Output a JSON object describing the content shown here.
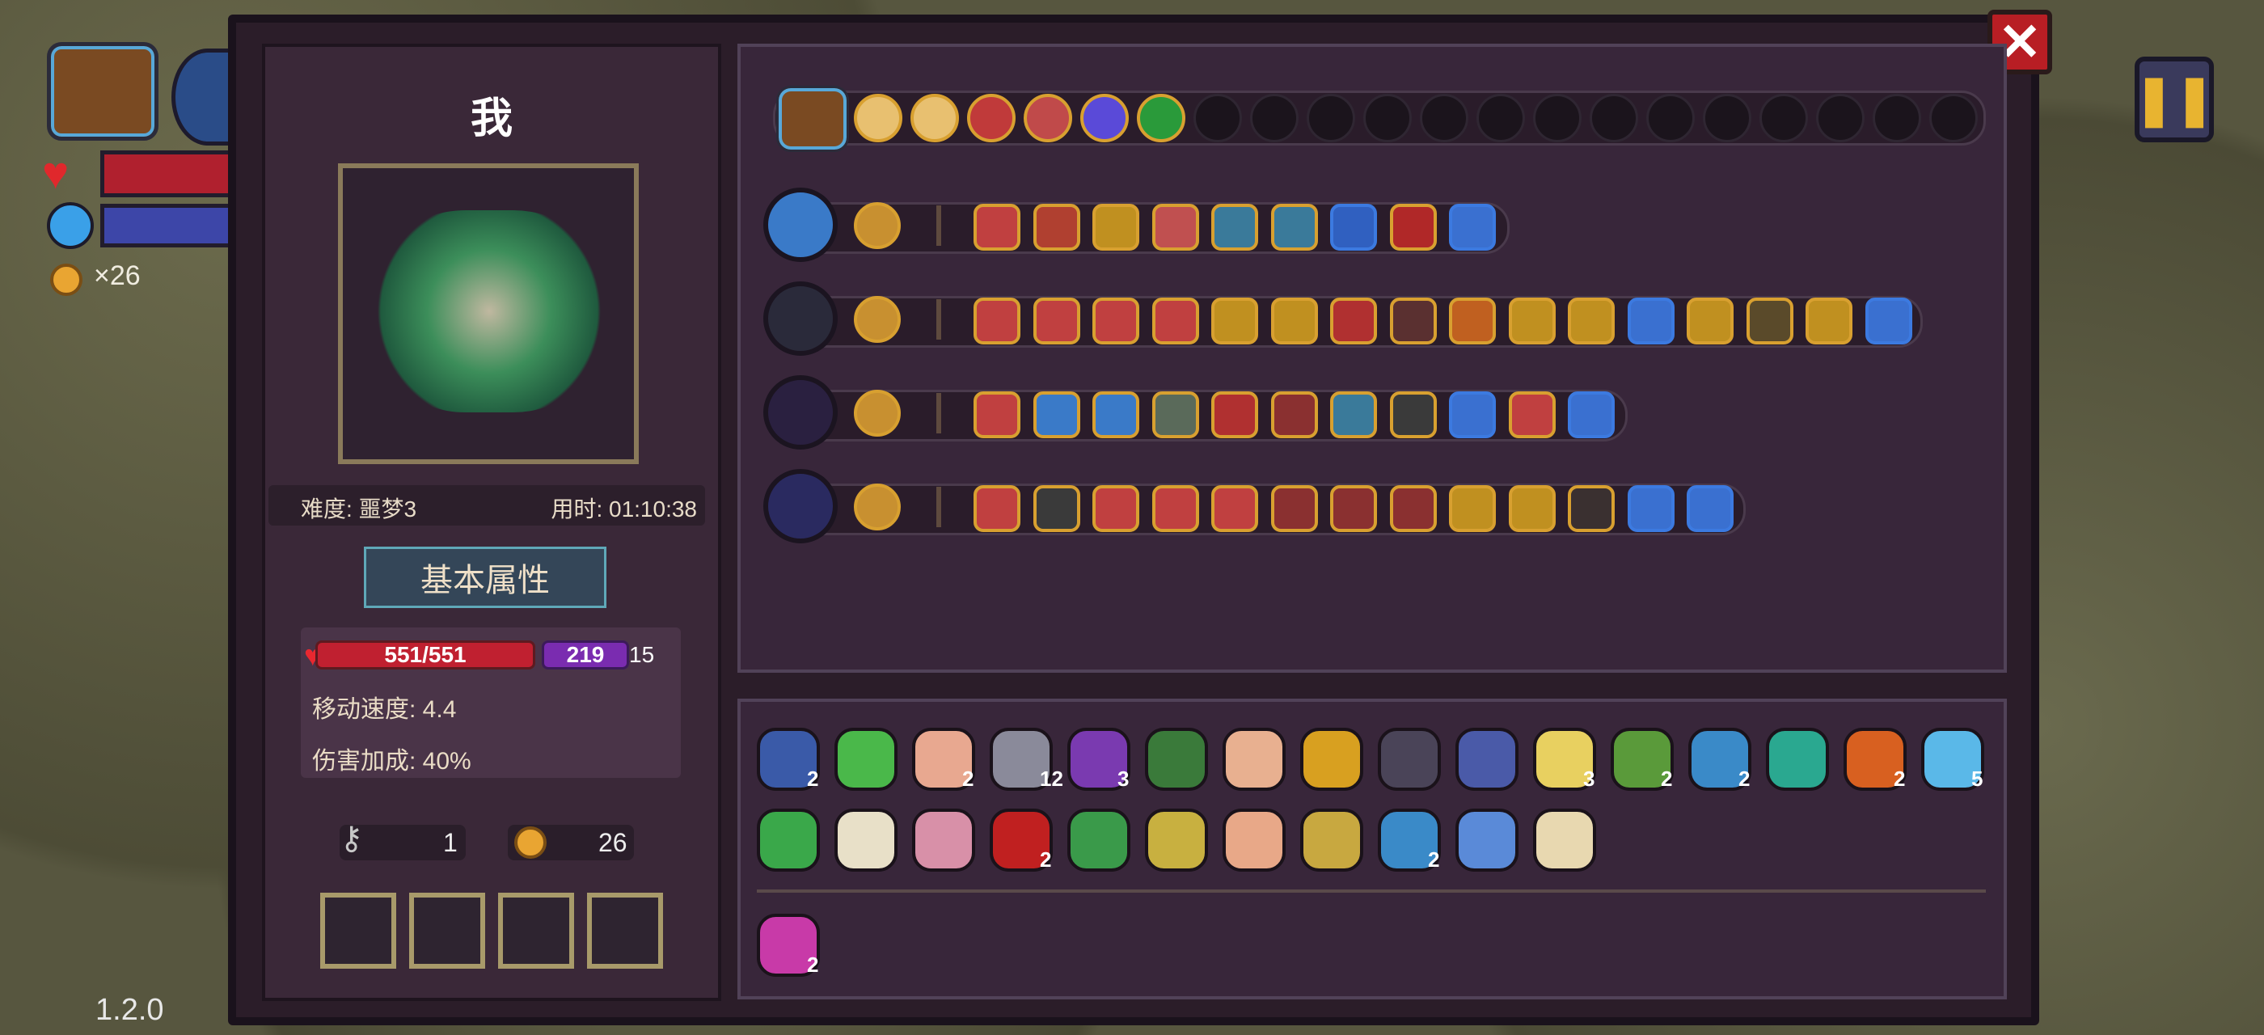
{
  "hud": {
    "coin_count": "×26",
    "version": "1.2.0",
    "pause_icon": "pause-icon",
    "chest_icon": "chest-icon",
    "heart_icon": "heart-icon",
    "mana_icon": "mana-orb-icon"
  },
  "panel": {
    "close_label": "✕",
    "player_name": "我",
    "difficulty": "难度: 噩梦3",
    "time": "用时: 01:10:38",
    "stats_title": "基本属性",
    "hp": "551/551",
    "mp": "219",
    "mp_extra": "15",
    "move_speed": "移动速度: 4.4",
    "damage_bonus": "伤害加成: 40%",
    "keys": "1",
    "coins": "26"
  },
  "colors": {
    "panel_bg": "#2b1d29",
    "gold_border": "#d8a030",
    "blue_border": "#3c7ae0",
    "hp_red": "#c02030",
    "mp_purple": "#7a2cb0"
  },
  "top_row": {
    "filled_colors": [
      "#e8c070",
      "#e8c070",
      "#c03a3a",
      "#c04a4a",
      "#5a4ad8",
      "#2a9a3a"
    ],
    "empty_count": 14
  },
  "weapon_rows": [
    {
      "weapon": "blue-flower-weapon",
      "color": "#3a7ac8",
      "skills": [
        "#c04040",
        "#b04030",
        "#c09020",
        "#c05050",
        "#3a7a9a",
        "#3a7a9a",
        "#3060c0",
        "#b02828",
        "#3a70d0"
      ],
      "blue": [
        6,
        8
      ]
    },
    {
      "weapon": "mace-weapon",
      "color": "#2a2a3a",
      "skills": [
        "#c04040",
        "#c04040",
        "#c04040",
        "#c04040",
        "#c09020",
        "#c09020",
        "#b03030",
        "#5a3030",
        "#c06020",
        "#c09020",
        "#c09020",
        "#3a70d0",
        "#c09020",
        "#5a4a2a",
        "#c09020",
        "#3a70d0"
      ],
      "blue": [
        11,
        15
      ]
    },
    {
      "weapon": "staff-weapon",
      "color": "#2a2040",
      "skills": [
        "#c04040",
        "#3a7ac8",
        "#3a7ac8",
        "#5a6a5a",
        "#b03030",
        "#8a3030",
        "#3a7a9a",
        "#3a3a3a",
        "#3a70d0",
        "#c04040",
        "#3a70d0"
      ],
      "blue": [
        8,
        10
      ]
    },
    {
      "weapon": "vortex-weapon",
      "color": "#2a2a60",
      "skills": [
        "#c04040",
        "#3a3a3a",
        "#c04040",
        "#c04040",
        "#c04040",
        "#8a3030",
        "#8a3030",
        "#8a3030",
        "#c09020",
        "#c09020",
        "#3a3030",
        "#3a70d0",
        "#3a70d0"
      ],
      "blue": [
        11,
        12
      ]
    }
  ],
  "items_row1": [
    {
      "name": "blue-jelly-item",
      "color": "#3a5aa8",
      "count": "2"
    },
    {
      "name": "syringe-item",
      "color": "#4ab84a",
      "count": ""
    },
    {
      "name": "feather-item",
      "color": "#e8a890",
      "count": "2"
    },
    {
      "name": "dagger-item",
      "color": "#8a8a9a",
      "count": "12"
    },
    {
      "name": "witch-hat-item",
      "color": "#7a3ab0",
      "count": "3"
    },
    {
      "name": "green-belt-item",
      "color": "#3a7a3a",
      "count": ""
    },
    {
      "name": "egg-item",
      "color": "#e8b090",
      "count": ""
    },
    {
      "name": "leaf-item",
      "color": "#d8a020",
      "count": ""
    },
    {
      "name": "cloak-item",
      "color": "#4a4458",
      "count": ""
    },
    {
      "name": "glove-item",
      "color": "#4a5aa8",
      "count": ""
    },
    {
      "name": "cream-item",
      "color": "#e8d060",
      "count": "3"
    },
    {
      "name": "dragonfly-item",
      "color": "#5a9a3a",
      "count": "2"
    },
    {
      "name": "wind-arrow-item",
      "color": "#3a8ac8",
      "count": "2"
    },
    {
      "name": "shell-item",
      "color": "#2aa890",
      "count": ""
    },
    {
      "name": "fire-bow-item",
      "color": "#d86020",
      "count": "2"
    },
    {
      "name": "ice-arrow-item",
      "color": "#5ab8e8",
      "count": "5"
    }
  ],
  "items_row2": [
    {
      "name": "clover-item",
      "color": "#3aa84a",
      "count": ""
    },
    {
      "name": "teeth-item",
      "color": "#e8e0c8",
      "count": ""
    },
    {
      "name": "brain-item",
      "color": "#d890a8",
      "count": ""
    },
    {
      "name": "red-eye-item",
      "color": "#c02020",
      "count": "2"
    },
    {
      "name": "ufo-item",
      "color": "#3a9a4a",
      "count": ""
    },
    {
      "name": "plus-sword-item",
      "color": "#c8b040",
      "count": ""
    },
    {
      "name": "hand-item",
      "color": "#e8a888",
      "count": ""
    },
    {
      "name": "dice-item",
      "color": "#c8a840",
      "count": ""
    },
    {
      "name": "magnifier-item",
      "color": "#3a8ac8",
      "count": "2"
    },
    {
      "name": "worm-item",
      "color": "#5a8ad8",
      "count": ""
    },
    {
      "name": "moth-item",
      "color": "#e8d8b0",
      "count": ""
    }
  ],
  "items_row3": [
    {
      "name": "pink-swirl-item",
      "color": "#c83aa8",
      "count": "2"
    }
  ]
}
